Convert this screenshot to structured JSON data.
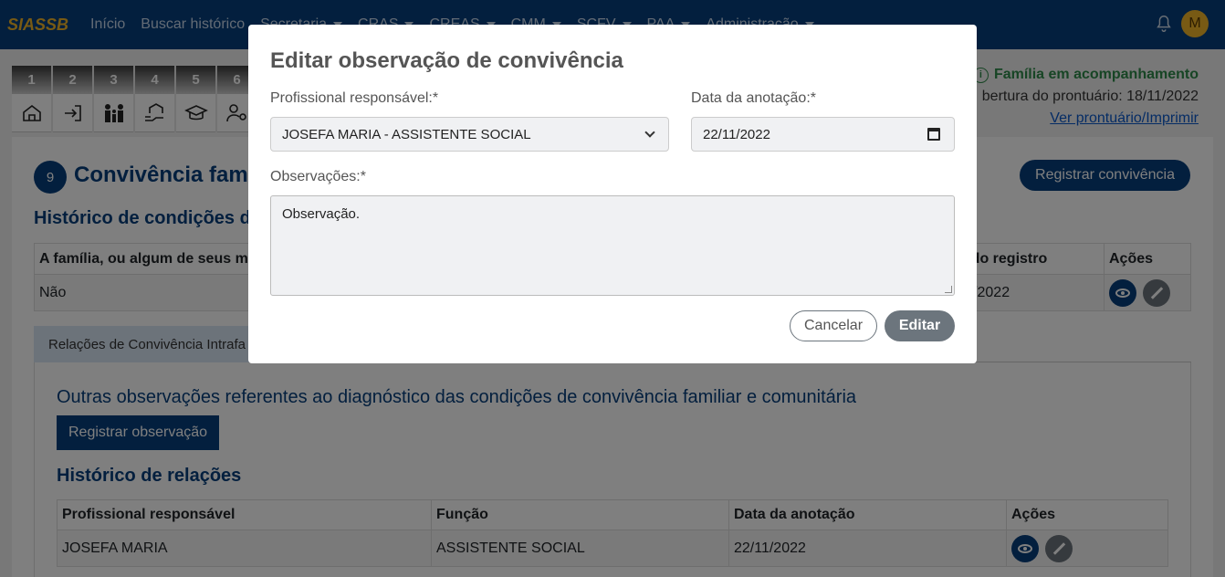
{
  "navbar": {
    "brand": "SIASSB",
    "links": [
      "Início",
      "Buscar histórico"
    ],
    "dropdowns": [
      "Secretaria",
      "CRAS",
      "CREAS",
      "CMM",
      "SCFV",
      "PAA",
      "Administração"
    ],
    "avatar_initial": "M"
  },
  "steps": [
    "1",
    "2",
    "3",
    "4",
    "5",
    "6"
  ],
  "family_info": {
    "status": "Família em acompanhamento",
    "opening": "bertura do prontuário: 18/11/2022",
    "view_link": "Ver prontuário/Imprimir"
  },
  "section": {
    "number": "9",
    "title": "Convivência fami",
    "register_button": "Registrar convivência",
    "history_title": "Histórico de condições de",
    "table": {
      "headers": [
        "A família, ou algum de seus me",
        "ta do registro",
        "Ações"
      ],
      "rows": [
        [
          "Não",
          "/11/2022"
        ]
      ]
    },
    "tab_label": "Relações de Convivência Intrafa",
    "obs_title": "Outras observações referentes ao diagnóstico das condições de convivência familiar e comunitária",
    "obs_button": "Registrar observação",
    "relations_title": "Histórico de relações",
    "relations_table": {
      "headers": [
        "Profissional responsável",
        "Função",
        "Data da anotação",
        "Ações"
      ],
      "rows": [
        [
          "JOSEFA MARIA",
          "ASSISTENTE SOCIAL",
          "22/11/2022"
        ]
      ]
    }
  },
  "modal": {
    "title": "Editar observação de convivência",
    "professional_label": "Profissional responsável:*",
    "professional_value": "JOSEFA MARIA - ASSISTENTE SOCIAL",
    "date_label": "Data da anotação:*",
    "date_value": "22/11/2022",
    "observations_label": "Observações:*",
    "observations_value": "Observação.",
    "cancel_label": "Cancelar",
    "edit_label": "Editar"
  },
  "colors": {
    "primary": "#063e7c",
    "brand": "#f0b429",
    "success": "#2f8a4a",
    "secondary": "#6c757d"
  }
}
